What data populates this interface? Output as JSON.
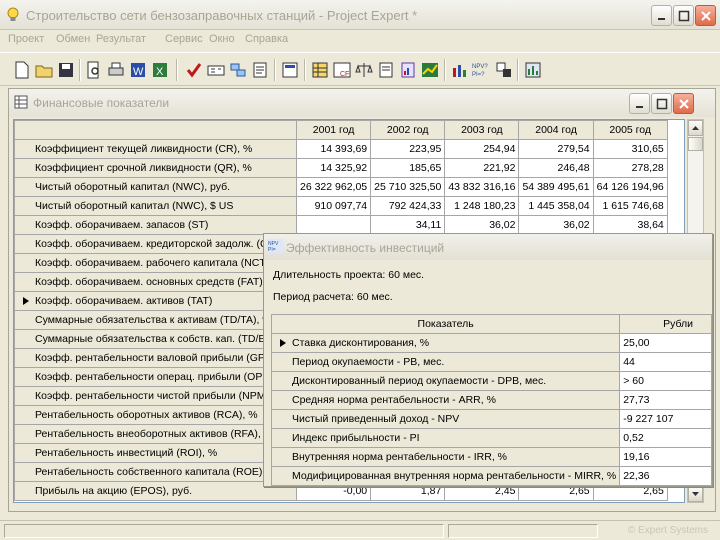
{
  "app": {
    "title": "Строительство сети бензозаправочных станций - Project Expert *"
  },
  "menu": [
    "Проект",
    "Обмен",
    "Результат",
    "Сервис",
    "Окно",
    "Справка"
  ],
  "toolbar_icons": [
    "new-document-icon",
    "open-folder-icon",
    "save-disk-icon",
    "print-preview-icon",
    "print-icon",
    "word-export-icon",
    "excel-export-icon",
    "check-mark-icon",
    "calculator-icon",
    "model-icon",
    "notes-icon",
    "report-icon",
    "table-icon",
    "cash-flow-icon",
    "balance-scale-icon",
    "document-icon",
    "chart-icon",
    "color-chart-icon",
    "npv-pi-icon",
    "sensitivity-icon",
    "analysis-icon"
  ],
  "financial_window": {
    "title": "Финансовые показатели",
    "years": [
      "2001 год",
      "2002 год",
      "2003 год",
      "2004 год",
      "2005 год"
    ],
    "rows": [
      {
        "label": "Коэффициент текущей ликвидности (CR), %",
        "values": [
          "14 393,69",
          "223,95",
          "254,94",
          "279,54",
          "310,65"
        ]
      },
      {
        "label": "Коэффициент срочной ликвидности (QR), %",
        "values": [
          "14 325,92",
          "185,65",
          "221,92",
          "246,48",
          "278,28"
        ]
      },
      {
        "label": "Чистый оборотный капитал (NWC), руб.",
        "values": [
          "26 322 962,05",
          "25 710 325,50",
          "43 832 316,16",
          "54 389 495,61",
          "64 126 194,96"
        ]
      },
      {
        "label": "Чистый оборотный капитал (NWC), $ US",
        "values": [
          "910 097,74",
          "792 424,33",
          "1 248 180,23",
          "1 445 358,04",
          "1 615 746,68"
        ]
      },
      {
        "label": "Коэфф. оборачиваем. запасов (ST)",
        "values": [
          "",
          "34,11",
          "36,02",
          "36,02",
          "38,64"
        ]
      },
      {
        "label": "Коэфф. оборачиваем. кредиторской задолж. (CP)",
        "values": [
          "",
          "",
          "",
          "",
          ""
        ]
      },
      {
        "label": "Коэфф. оборачиваем. рабочего капитала (NCT)",
        "values": [
          "",
          "",
          "",
          "",
          ""
        ]
      },
      {
        "label": "Коэфф. оборачиваем. основных средств (FAT)",
        "values": [
          "",
          "",
          "",
          "",
          ""
        ]
      },
      {
        "label": "Коэфф. оборачиваем. активов (TAT)",
        "values": [
          "",
          "",
          "",
          "",
          ""
        ],
        "selected": true
      },
      {
        "label": "Суммарные обязательства к активам (TD/TA), %",
        "values": [
          "",
          "",
          "",
          "",
          ""
        ]
      },
      {
        "label": "Суммарные обязательства к собств. кап. (TD/EQ), %",
        "values": [
          "",
          "",
          "",
          "",
          ""
        ]
      },
      {
        "label": "Коэфф. рентабельности валовой прибыли (GPM), %",
        "values": [
          "",
          "",
          "",
          "",
          ""
        ]
      },
      {
        "label": "Коэфф. рентабельности операц. прибыли (OPM), %",
        "values": [
          "",
          "",
          "",
          "",
          ""
        ]
      },
      {
        "label": "Коэфф. рентабельности чистой прибыли (NPM), %",
        "values": [
          "",
          "",
          "",
          "",
          ""
        ]
      },
      {
        "label": "Рентабельность оборотных активов (RCA), %",
        "values": [
          "",
          "",
          "",
          "",
          ""
        ]
      },
      {
        "label": "Рентабельность внеоборотных активов (RFA), %",
        "values": [
          "",
          "",
          "",
          "",
          ""
        ]
      },
      {
        "label": "Рентабельность инвестиций (ROI), %",
        "values": [
          "",
          "",
          "",
          "",
          ""
        ]
      },
      {
        "label": "Рентабельность собственного капитала (ROE), %",
        "values": [
          "",
          "",
          "",
          "",
          ""
        ]
      },
      {
        "label": "Прибыль на акцию (EPOS), руб.",
        "values": [
          "-0,00",
          "1,87",
          "2,45",
          "2,65",
          "2,65"
        ]
      }
    ]
  },
  "investment_window": {
    "title": "Эффективность инвестиций",
    "duration": "Длительность проекта: 60 мес.",
    "period": "Период расчета: 60 мес.",
    "col_indicator": "Показатель",
    "col_currency": "Рубли",
    "rows": [
      {
        "label": "Ставка дисконтирования, %",
        "value": "25,00",
        "selected": true
      },
      {
        "label": "Период окупаемости - PB, мес.",
        "value": "44"
      },
      {
        "label": "Дисконтированный период окупаемости - DPB, мес.",
        "value": "> 60"
      },
      {
        "label": "Средняя норма рентабельности - ARR, %",
        "value": "27,73"
      },
      {
        "label": "Чистый приведенный доход - NPV",
        "value": "-9 227 107"
      },
      {
        "label": "Индекс прибыльности - PI",
        "value": "0,52"
      },
      {
        "label": "Внутренняя норма рентабельности - IRR, %",
        "value": "19,16"
      },
      {
        "label": "Модифицированная внутренняя норма рентабельности - MIRR, %",
        "value": "22,36"
      }
    ]
  },
  "status": {
    "brand": "© Expert Systems"
  },
  "colors": {
    "window_bg": "#ece9d8",
    "grid_border": "#a6a6a6",
    "close_button": "#e06a4a"
  }
}
